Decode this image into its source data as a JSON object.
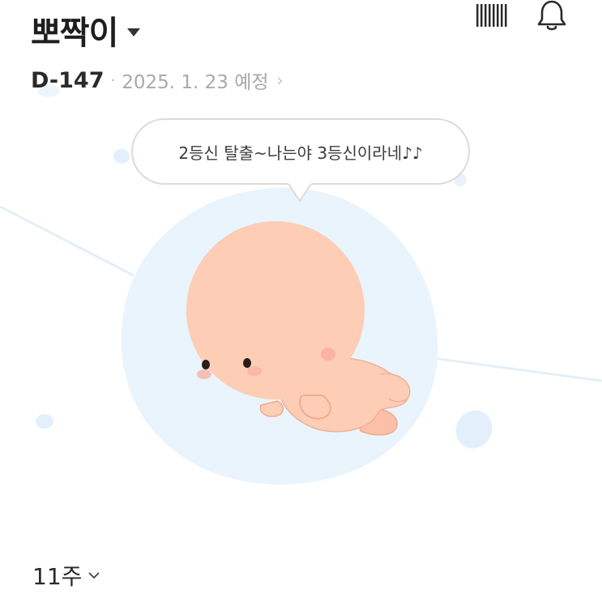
{
  "header": {
    "name": "뽀짝이",
    "caret_icon": "caret-down-icon",
    "icons": [
      "barcode-icon",
      "bell-icon"
    ]
  },
  "dday": {
    "count": "D-147",
    "separator": "·",
    "due_date": "2025. 1. 23 예정",
    "chevron": "›"
  },
  "bubble": {
    "message": "2등신 탈출~나는야 3등신이라네♪♪"
  },
  "week": {
    "label": "11주",
    "chevron_icon": "chevron-down-icon"
  },
  "colors": {
    "blob": "#eaf4fd",
    "baby_skin": "#fdcdb6",
    "baby_outline": "#f0a98b",
    "cheek": "#fbb3a3"
  }
}
